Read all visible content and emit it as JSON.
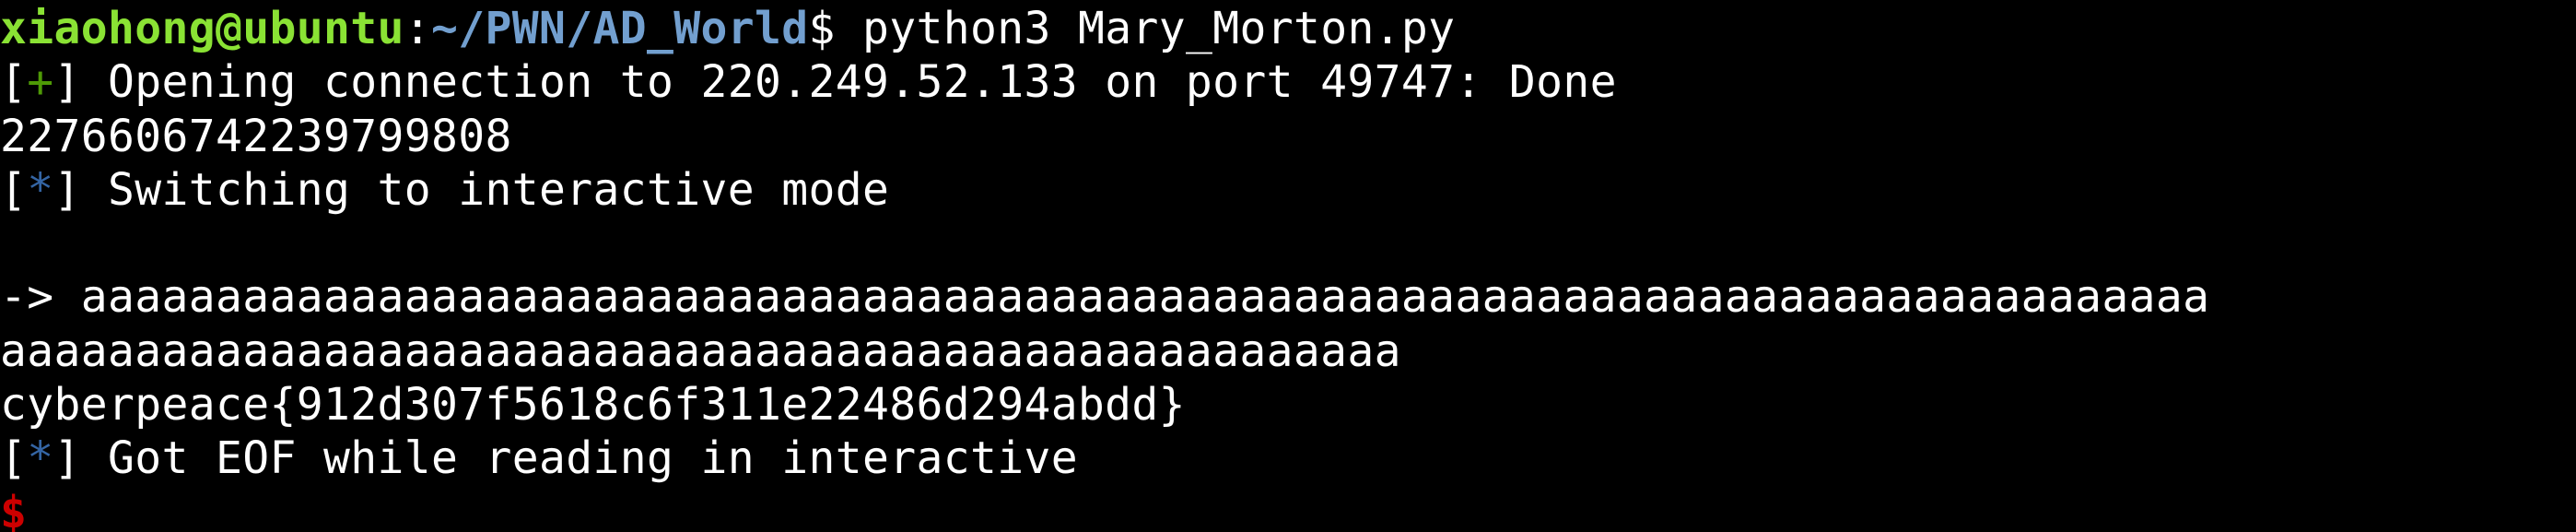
{
  "terminal": {
    "prompt": {
      "user_host": "xiaohong@ubuntu",
      "separator": ":",
      "path": "~/PWN/AD_World",
      "symbol": "$",
      "command": " python3 Mary_Morton.py"
    },
    "lines": {
      "l1_open": "[",
      "l1_marker": "+",
      "l1_close": "]",
      "l1_text": " Opening connection to 220.249.52.133 on port 49747: Done",
      "l2_text": "2276606742239799808",
      "l3_open": "[",
      "l3_marker": "*",
      "l3_close": "]",
      "l3_text": " Switching to interactive mode",
      "l5_text": "-> aaaaaaaaaaaaaaaaaaaaaaaaaaaaaaaaaaaaaaaaaaaaaaaaaaaaaaaaaaaaaaaaaaaaaaaaaaaaaaa",
      "l6_text": "aaaaaaaaaaaaaaaaaaaaaaaaaaaaaaaaaaaaaaaaaaaaaaaaaaaa",
      "l7_text": "cyberpeace{912d307f5618c6f311e22486d294abdd}",
      "l8_open": "[",
      "l8_marker": "*",
      "l8_close": "]",
      "l8_text": " Got EOF while reading in interactive",
      "l9_text": "$"
    },
    "colors": {
      "background": "#000000",
      "text": "#ffffff",
      "user_host": "#8ae234",
      "path": "#729fcf",
      "plus_marker": "#4e9a06",
      "star_marker": "#3465a4",
      "final_prompt": "#cc0000"
    }
  }
}
